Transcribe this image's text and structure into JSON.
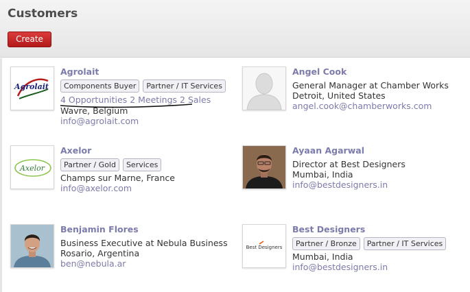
{
  "header": {
    "title": "Customers",
    "create_label": "Create"
  },
  "customers": [
    {
      "name": "Agrolait",
      "logo_text": "Agrolait",
      "tags": [
        "Components Buyer",
        "Partner / IT Services"
      ],
      "stats": {
        "opportunities": "4 Opportunities",
        "meetings": "2 Meetings",
        "sales": "2 Sales"
      },
      "location": "Wavre, Belgium",
      "email": "info@agrolait.com"
    },
    {
      "name": "Angel Cook",
      "job": "General Manager at Chamber Works",
      "location": "Detroit, United States",
      "email": "angel.cook@chamberworks.com"
    },
    {
      "name": "Axelor",
      "logo_text": "Axelor",
      "tags": [
        "Partner / Gold",
        "Services"
      ],
      "location": "Champs sur Marne, France",
      "email": "info@axelor.com"
    },
    {
      "name": "Ayaan Agarwal",
      "job": "Director at Best Designers",
      "location": "Mumbai, India",
      "email": "info@bestdesigners.in"
    },
    {
      "name": "Benjamin Flores",
      "job": "Business Executive at Nebula Business",
      "location": "Rosario, Argentina",
      "email": "ben@nebula.ar"
    },
    {
      "name": "Best Designers",
      "logo_text": "Best Designers",
      "tags": [
        "Partner / Bronze",
        "Partner / IT Services"
      ],
      "location": "Mumbai, India",
      "email": "info@bestdesigners.in"
    }
  ],
  "colors": {
    "accent": "#7c7bad",
    "create_button": "#c62828",
    "header_bg": "#ececec"
  }
}
